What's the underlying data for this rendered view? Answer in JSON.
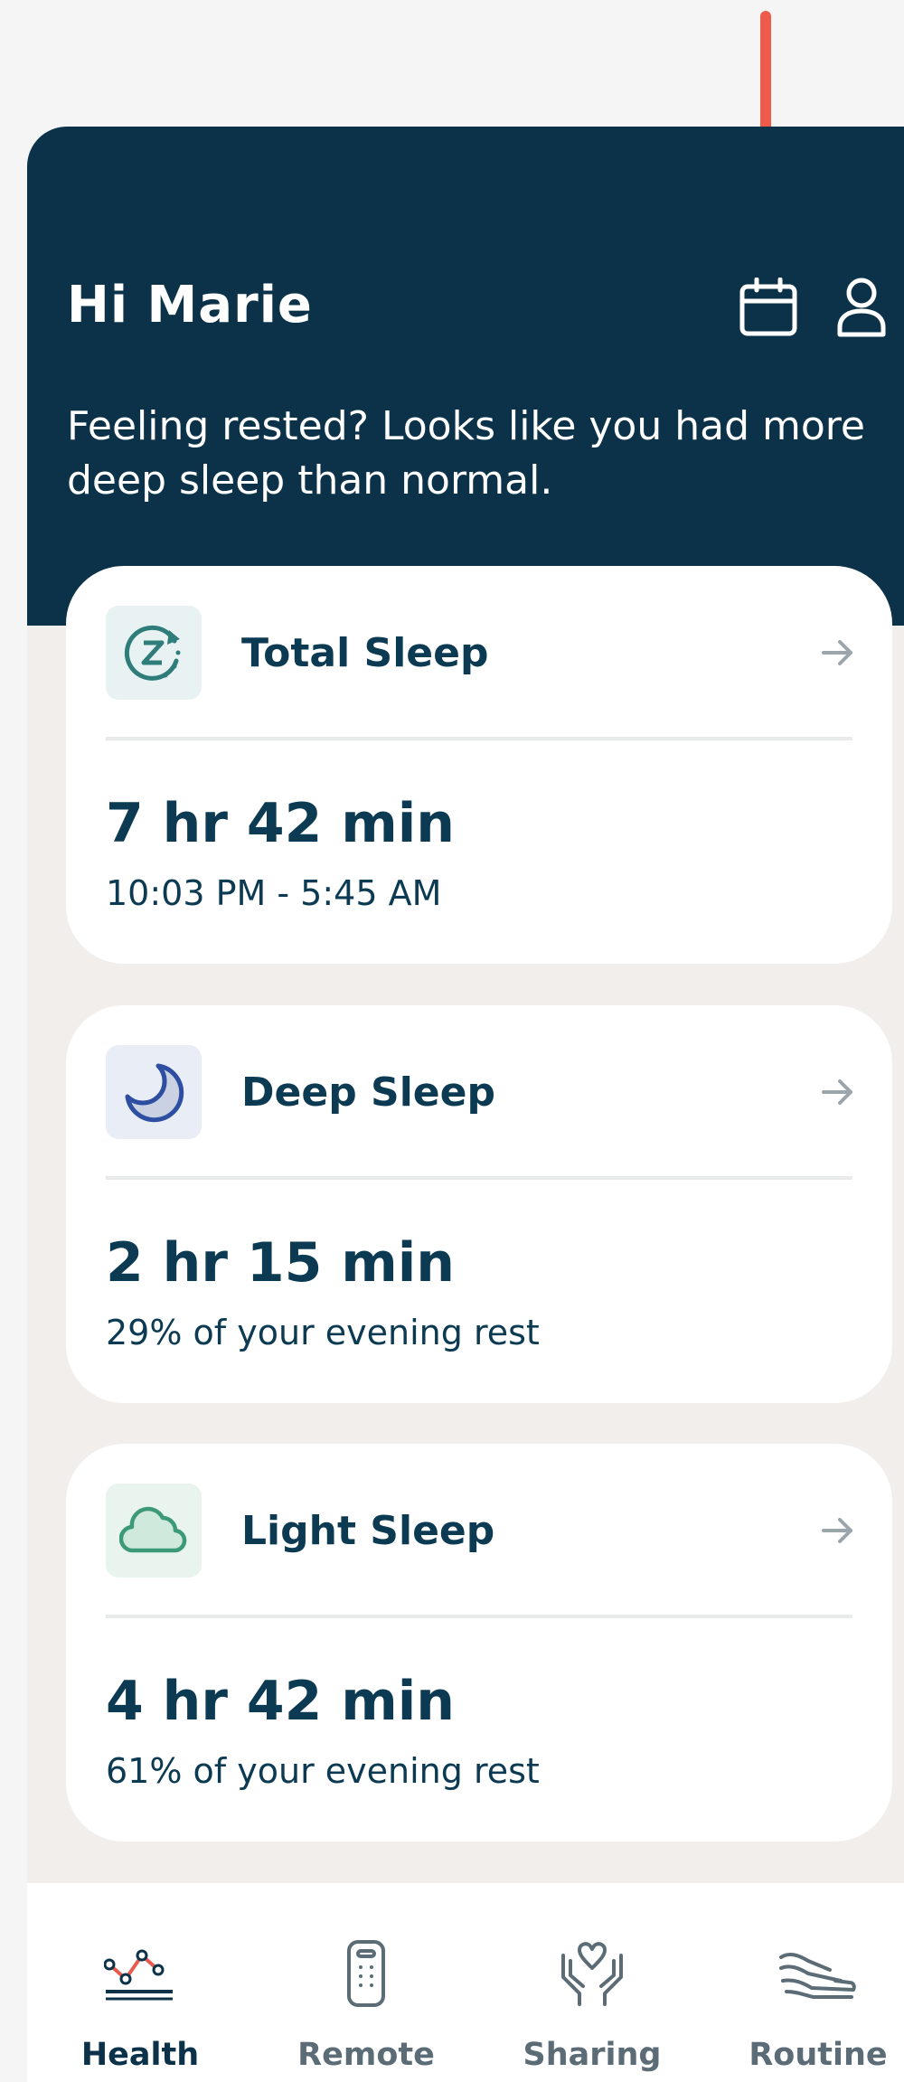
{
  "header": {
    "greeting": "Hi Marie",
    "message": "Feeling rested? Looks like you had more deep sleep than normal.",
    "calendar_icon": "calendar-icon",
    "profile_icon": "person-icon"
  },
  "cards": [
    {
      "title": "Total Sleep",
      "value": "7 hr 42 min",
      "detail": "10:03 PM - 5:45 AM",
      "icon": "sleep-cycle-icon",
      "icon_bg": "#e8f2f2",
      "icon_color": "#2f7d7a"
    },
    {
      "title": "Deep Sleep",
      "value": "2 hr 15 min",
      "detail": "29% of your evening rest",
      "icon": "moon-icon",
      "icon_bg": "#e9edf6",
      "icon_color": "#2d4ea1"
    },
    {
      "title": "Light Sleep",
      "value": "4 hr 42 min",
      "detail": "61% of your evening rest",
      "icon": "cloud-icon",
      "icon_bg": "#e9f4ef",
      "icon_color": "#3d9a78"
    }
  ],
  "tabs": [
    {
      "label": "Health",
      "icon": "health-chart-icon",
      "active": true
    },
    {
      "label": "Remote",
      "icon": "remote-icon",
      "active": false
    },
    {
      "label": "Sharing",
      "icon": "heart-hands-icon",
      "active": false
    },
    {
      "label": "Routine",
      "icon": "routine-icon",
      "active": false
    }
  ],
  "colors": {
    "header_bg": "#0b3249",
    "text": "#0b3a52",
    "accent_arrow": "#f05a4b",
    "health_accent": "#e85b4f"
  }
}
